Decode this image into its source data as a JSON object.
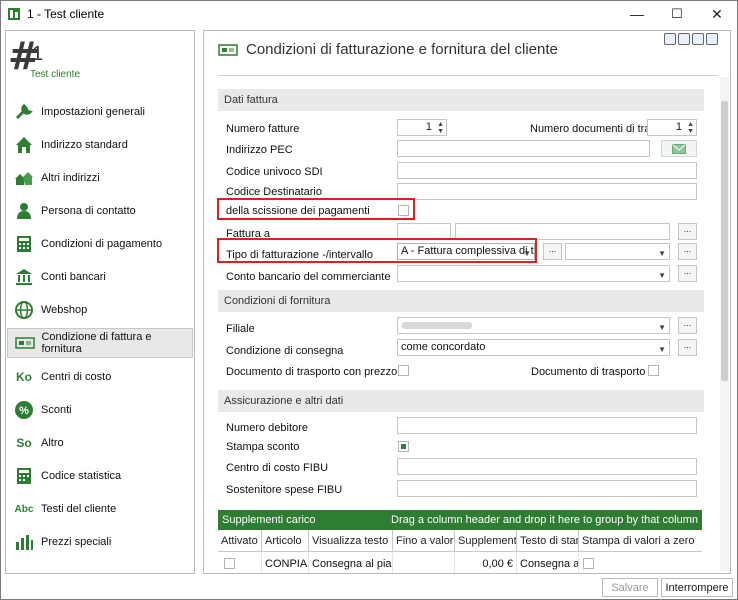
{
  "window": {
    "title": "1 - Test cliente",
    "minimize": "—",
    "maximize": "☐",
    "close": "✕"
  },
  "sidebar": {
    "hash": "#",
    "number": "1",
    "customer_label": "Test cliente",
    "items": [
      {
        "label": "Impostazioni generali",
        "icon": "wrench-icon"
      },
      {
        "label": "Indirizzo standard",
        "icon": "house-icon"
      },
      {
        "label": "Altri indirizzi",
        "icon": "houses-icon"
      },
      {
        "label": "Persona di contatto",
        "icon": "person-icon"
      },
      {
        "label": "Condizioni di pagamento",
        "icon": "calculator-icon"
      },
      {
        "label": "Conti bancari",
        "icon": "bank-icon"
      },
      {
        "label": "Webshop",
        "icon": "globe-icon"
      },
      {
        "label": "Condizione di fattura e fornitura",
        "icon": "invoice-icon"
      },
      {
        "label": "Centri di costo",
        "icon_text": "Ko"
      },
      {
        "label": "Sconti",
        "icon": "percent-icon"
      },
      {
        "label": "Altro",
        "icon_text": "So"
      },
      {
        "label": "Codice statistica",
        "icon": "stats-icon"
      },
      {
        "label": "Testi del cliente",
        "icon_text": "Abc"
      },
      {
        "label": "Prezzi speciali",
        "icon": "chart-icon"
      }
    ]
  },
  "main": {
    "title": "Condizioni di fatturazione e fornitura del cliente",
    "sections": {
      "invoice": "Dati fattura",
      "delivery": "Condizioni di fornitura",
      "insurance": "Assicurazione e altri dati"
    },
    "fields": {
      "numero_fatture_label": "Numero fatture",
      "numero_fatture_value": "1",
      "numero_documenti_label": "Numero documenti di tras",
      "numero_documenti_value": "1",
      "indirizzo_pec_label": "Indirizzo PEC",
      "codice_sdi_label": "Codice univoco SDI",
      "codice_destinatario_label": "Codice Destinatario",
      "scissione_label": "della scissione dei pagamenti",
      "fattura_a_label": "Fattura a",
      "tipo_fatturazione_label": "Tipo di fatturazione -/intervallo",
      "tipo_fatturazione_value": "A - Fattura complessiva di t",
      "conto_bancario_label": "Conto bancario del commerciante",
      "filiale_label": "Filiale",
      "condizione_consegna_label": "Condizione di consegna",
      "condizione_consegna_value": "come concordato",
      "doc_trasporto_prezzo_label": "Documento di trasporto con prezzo",
      "doc_trasporto_in_label": "Documento di trasporto in",
      "numero_debitore_label": "Numero debitore",
      "stampa_sconto_label": "Stampa sconto",
      "centro_costo_label": "Centro di costo FIBU",
      "sostenitore_label": "Sostenitore spese FIBU",
      "dots": "..."
    },
    "grid": {
      "title": "Supplementi carico",
      "group_hint": "Drag a column header and drop it here to group by that column",
      "columns": [
        "Attivato",
        "Articolo",
        "Visualizza testo",
        "Fino a valore",
        "Supplement",
        "Testo di stan",
        "Stampa di valori a zero"
      ],
      "rows": [
        [
          "",
          "CONPIA +",
          "Consegna al piano",
          "",
          "0,00 €",
          "Consegna al p",
          ""
        ]
      ]
    }
  },
  "footer": {
    "save": "Salvare",
    "cancel": "Interrompere"
  },
  "colors": {
    "accent": "#2e7d32",
    "highlight": "#e02020"
  }
}
